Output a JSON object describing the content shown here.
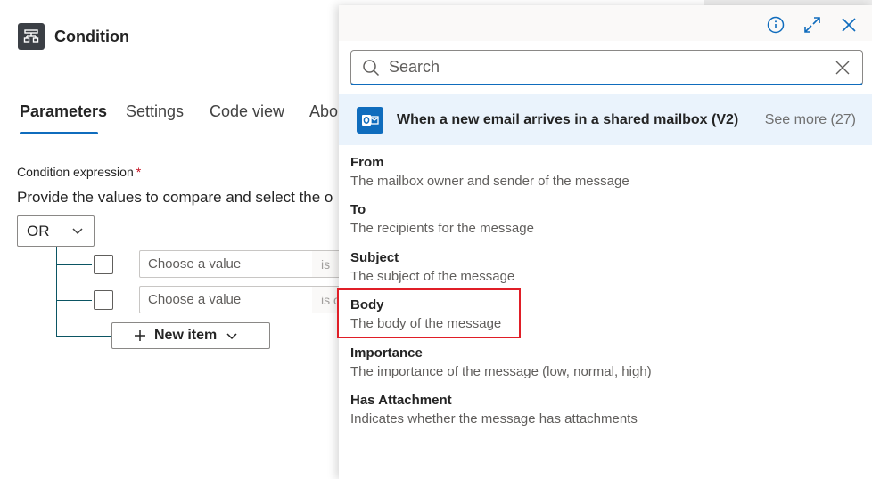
{
  "header": {
    "title": "Condition",
    "icon": "condition-icon"
  },
  "tabs": [
    {
      "label": "Parameters",
      "active": true
    },
    {
      "label": "Settings",
      "active": false
    },
    {
      "label": "Code view",
      "active": false
    },
    {
      "label": "Abo",
      "active": false
    }
  ],
  "condition": {
    "label": "Condition expression",
    "required_mark": "*",
    "description": "Provide the values to compare and select the o",
    "group_operator": "OR",
    "rows": [
      {
        "placeholder": "Choose a value",
        "operator": "is"
      },
      {
        "placeholder": "Choose a value",
        "operator": "is o"
      }
    ],
    "new_item_label": "New item"
  },
  "flyout": {
    "search_placeholder": "Search",
    "trigger": {
      "title": "When a new email arrives in a shared mailbox (V2)",
      "see_more": "See more (27)"
    },
    "tokens": [
      {
        "name": "From",
        "description": "The mailbox owner and sender of the message"
      },
      {
        "name": "To",
        "description": "The recipients for the message"
      },
      {
        "name": "Subject",
        "description": "The subject of the message"
      },
      {
        "name": "Body",
        "description": "The body of the message"
      },
      {
        "name": "Importance",
        "description": "The importance of the message (low, normal, high)"
      },
      {
        "name": "Has Attachment",
        "description": "Indicates whether the message has attachments"
      }
    ]
  },
  "colors": {
    "accent": "#0f6cbd",
    "highlight": "#e01e27",
    "tree_line": "#0b5563"
  }
}
